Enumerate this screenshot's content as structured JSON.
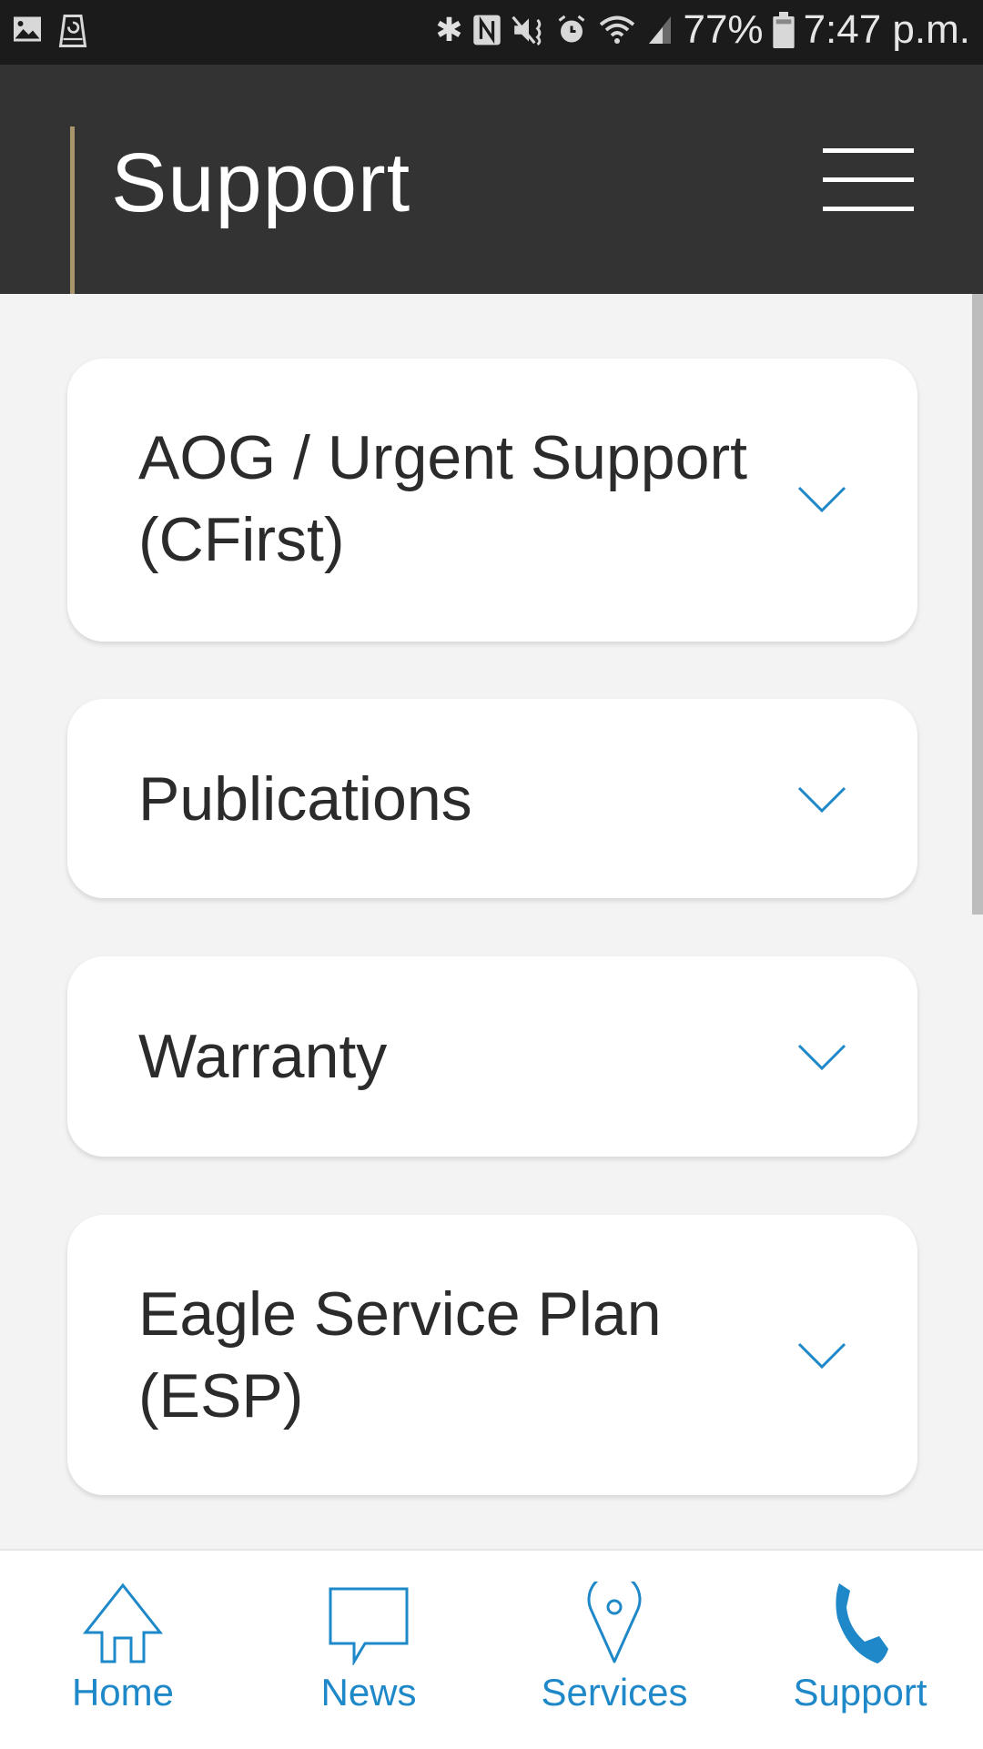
{
  "status_bar": {
    "left_icons": [
      "image-icon",
      "storage-sync-icon"
    ],
    "right_icons": [
      "bluetooth-icon",
      "nfc-icon",
      "vibrate-mute-icon",
      "alarm-icon",
      "wifi-icon",
      "signal-icon"
    ],
    "battery_percent": "77%",
    "time": "7:47 p.m."
  },
  "header": {
    "title": "Support",
    "accent_color": "#a8966a",
    "menu_icon": "hamburger-menu-icon"
  },
  "accordion": {
    "items": [
      {
        "label_line1": "AOG / Urgent Support",
        "label_line2": "(CFirst)",
        "icon": "chevron-down-icon",
        "expanded": false
      },
      {
        "label_line1": "Publications",
        "label_line2": "",
        "icon": "chevron-down-icon",
        "expanded": false
      },
      {
        "label_line1": "Warranty",
        "label_line2": "",
        "icon": "chevron-down-icon",
        "expanded": false
      },
      {
        "label_line1": "Eagle Service Plan",
        "label_line2": "(ESP)",
        "icon": "chevron-down-icon",
        "expanded": false
      }
    ],
    "chevron_color": "#1e88c8"
  },
  "bottom_nav": {
    "items": [
      {
        "label": "Home",
        "icon": "home-icon",
        "active": false
      },
      {
        "label": "News",
        "icon": "speech-bubble-icon",
        "active": false
      },
      {
        "label": "Services",
        "icon": "location-pin-icon",
        "active": false
      },
      {
        "label": "Support",
        "icon": "phone-icon",
        "active": true
      }
    ],
    "color": "#1e88c8"
  }
}
